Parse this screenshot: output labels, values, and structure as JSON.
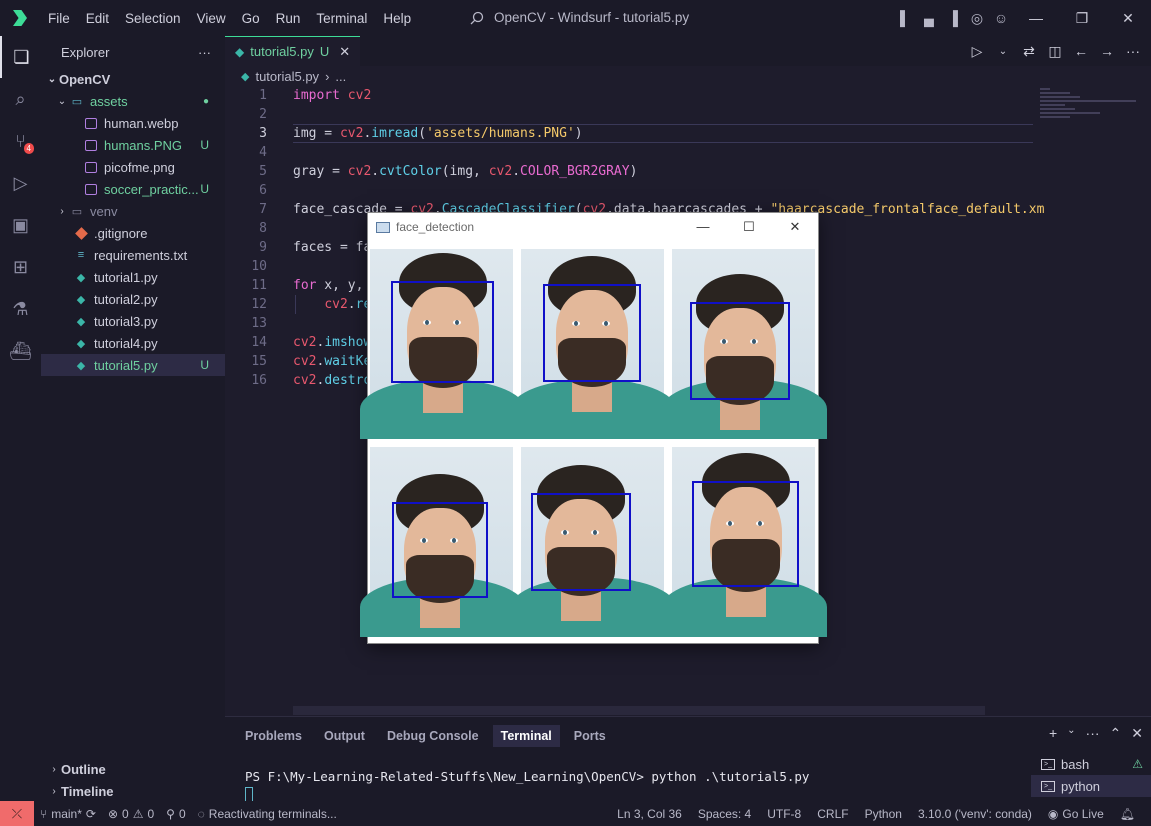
{
  "window": {
    "title": "OpenCV - Windsurf - tutorial5.py",
    "menu": [
      "File",
      "Edit",
      "Selection",
      "View",
      "Go",
      "Run",
      "Terminal",
      "Help"
    ]
  },
  "activity": {
    "scm_badge": "4"
  },
  "explorer": {
    "header": "Explorer",
    "more": "···",
    "root": "OpenCV",
    "items": [
      {
        "label": "assets",
        "kind": "folder-open",
        "status": "●",
        "depth": 1
      },
      {
        "label": "human.webp",
        "kind": "image",
        "status": "",
        "depth": 2
      },
      {
        "label": "humans.PNG",
        "kind": "image",
        "status": "U",
        "depth": 2
      },
      {
        "label": "picofme.png",
        "kind": "image",
        "status": "",
        "depth": 2
      },
      {
        "label": "soccer_practic...",
        "kind": "image",
        "status": "U",
        "depth": 2
      },
      {
        "label": "venv",
        "kind": "folder",
        "status": "",
        "depth": 1
      },
      {
        "label": ".gitignore",
        "kind": "git",
        "status": "",
        "depth": 1
      },
      {
        "label": "requirements.txt",
        "kind": "txt",
        "status": "",
        "depth": 1
      },
      {
        "label": "tutorial1.py",
        "kind": "py",
        "status": "",
        "depth": 1
      },
      {
        "label": "tutorial2.py",
        "kind": "py",
        "status": "",
        "depth": 1
      },
      {
        "label": "tutorial3.py",
        "kind": "py",
        "status": "",
        "depth": 1
      },
      {
        "label": "tutorial4.py",
        "kind": "py",
        "status": "",
        "depth": 1
      },
      {
        "label": "tutorial5.py",
        "kind": "py",
        "status": "U",
        "depth": 1
      }
    ],
    "outline": "Outline",
    "timeline": "Timeline"
  },
  "editor": {
    "tab_label": "tutorial5.py",
    "tab_status": "U",
    "breadcrumb_file": "tutorial5.py",
    "breadcrumb_more": "...",
    "lines": [
      {
        "n": "1",
        "text": "import cv2"
      },
      {
        "n": "2",
        "text": ""
      },
      {
        "n": "3",
        "text": "img = cv2.imread('assets/humans.PNG')"
      },
      {
        "n": "4",
        "text": ""
      },
      {
        "n": "5",
        "text": "gray = cv2.cvtColor(img, cv2.COLOR_BGR2GRAY)"
      },
      {
        "n": "6",
        "text": ""
      },
      {
        "n": "7",
        "text": "face_cascade = cv2.CascadeClassifier(cv2.data.haarcascades + \"haarcascade_frontalface_default.xm"
      },
      {
        "n": "8",
        "text": ""
      },
      {
        "n": "9",
        "text": "faces = fa"
      },
      {
        "n": "10",
        "text": ""
      },
      {
        "n": "11",
        "text": "for x, y,"
      },
      {
        "n": "12",
        "text": "    cv2.re"
      },
      {
        "n": "13",
        "text": ""
      },
      {
        "n": "14",
        "text": "cv2.imshow"
      },
      {
        "n": "15",
        "text": "cv2.waitKe"
      },
      {
        "n": "16",
        "text": "cv2.destro"
      }
    ]
  },
  "cv_window": {
    "title": "face_detection"
  },
  "panel": {
    "tabs": [
      "Problems",
      "Output",
      "Debug Console",
      "Terminal",
      "Ports"
    ],
    "active_tab": "Terminal",
    "terminal_line": "PS F:\\My-Learning-Related-Stuffs\\New_Learning\\OpenCV> python .\\tutorial5.py",
    "terminals": [
      "bash",
      "python"
    ]
  },
  "statusbar": {
    "branch": "main*",
    "errors": "0",
    "warnings": "0",
    "ports": "0",
    "message": "Reactivating terminals...",
    "position": "Ln 3, Col 36",
    "spaces": "Spaces: 4",
    "encoding": "UTF-8",
    "eol": "CRLF",
    "language": "Python",
    "interpreter": "3.10.0 ('venv': conda)",
    "golive": "Go Live"
  }
}
